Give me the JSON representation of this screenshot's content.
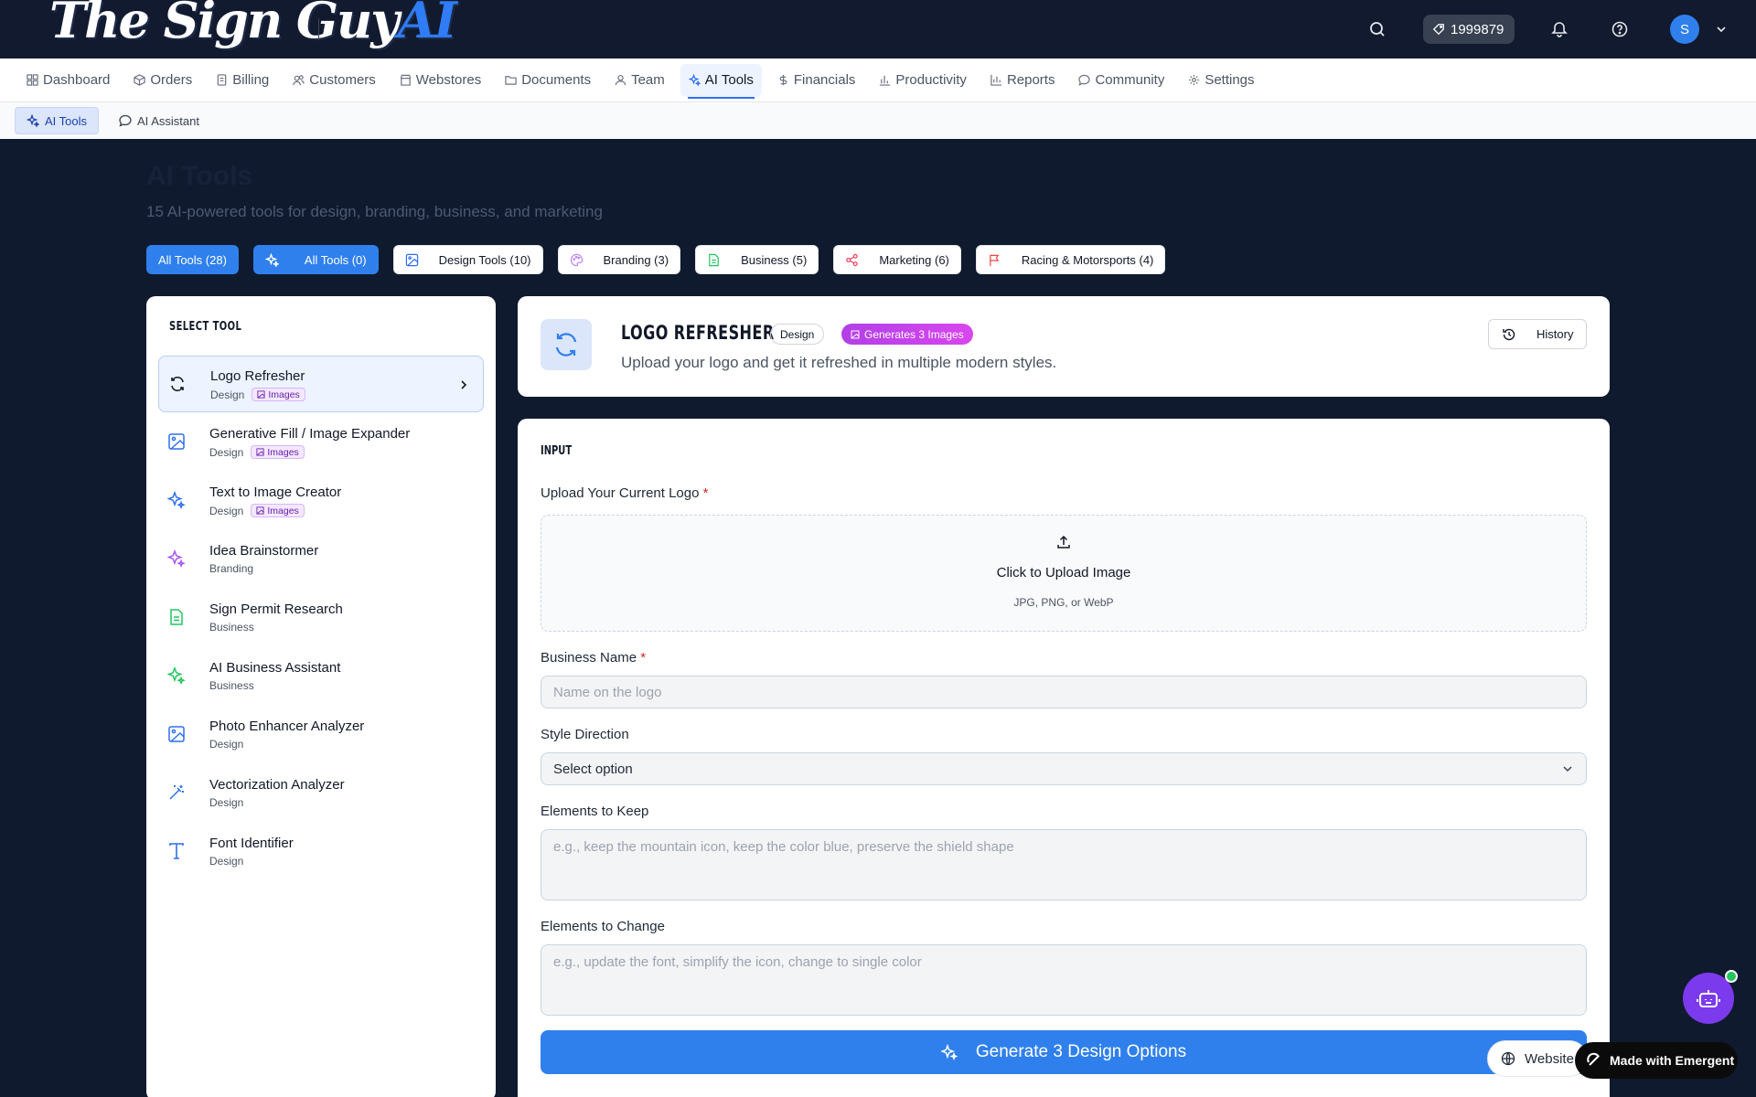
{
  "app": {
    "logo_main": "The Sign Guy",
    "logo_ai": "AI",
    "credits": "1999879",
    "avatar_initial": "S"
  },
  "nav": {
    "items": [
      {
        "label": "Dashboard",
        "icon": "grid-icon"
      },
      {
        "label": "Orders",
        "icon": "box-icon"
      },
      {
        "label": "Billing",
        "icon": "document-icon"
      },
      {
        "label": "Customers",
        "icon": "users-icon"
      },
      {
        "label": "Webstores",
        "icon": "store-icon"
      },
      {
        "label": "Documents",
        "icon": "folder-icon"
      },
      {
        "label": "Team",
        "icon": "user-icon"
      },
      {
        "label": "AI Tools",
        "icon": "sparkles-icon",
        "active": true
      },
      {
        "label": "Financials",
        "icon": "dollar-icon"
      },
      {
        "label": "Productivity",
        "icon": "bar-chart-icon"
      },
      {
        "label": "Reports",
        "icon": "chart-icon"
      },
      {
        "label": "Community",
        "icon": "chat-icon"
      },
      {
        "label": "Settings",
        "icon": "gear-icon"
      }
    ]
  },
  "subnav": {
    "items": [
      {
        "label": "AI Tools",
        "icon": "sparkles-icon",
        "active": true
      },
      {
        "label": "AI Assistant",
        "icon": "chat-icon"
      }
    ]
  },
  "page": {
    "title": "AI Tools",
    "subtitle": "15 AI-powered tools for design, branding, business, and marketing"
  },
  "filters": [
    {
      "label": "All Tools (28)"
    },
    {
      "label": "All Tools (0)",
      "icon": "sparkles-icon"
    },
    {
      "label": "Design Tools (10)",
      "icon": "image-icon"
    },
    {
      "label": "Branding (3)",
      "icon": "palette-icon"
    },
    {
      "label": "Business (5)",
      "icon": "file-icon"
    },
    {
      "label": "Marketing (6)",
      "icon": "share-icon"
    },
    {
      "label": "Racing & Motorsports (4)",
      "icon": "flag-icon"
    }
  ],
  "tool_list": {
    "title": "SELECT TOOL",
    "images_badge": "Images",
    "items": [
      {
        "name": "Logo Refresher",
        "category": "Design",
        "images": true,
        "selected": true,
        "icon": "refresh-icon"
      },
      {
        "name": "Generative Fill / Image Expander",
        "category": "Design",
        "images": true,
        "icon": "image-icon"
      },
      {
        "name": "Text to Image Creator",
        "category": "Design",
        "images": true,
        "icon": "sparkles-icon"
      },
      {
        "name": "Idea Brainstormer",
        "category": "Branding",
        "images": false,
        "icon": "sparkles-icon"
      },
      {
        "name": "Sign Permit Research",
        "category": "Business",
        "images": false,
        "icon": "file-icon"
      },
      {
        "name": "AI Business Assistant",
        "category": "Business",
        "images": false,
        "icon": "sparkles-icon"
      },
      {
        "name": "Photo Enhancer Analyzer",
        "category": "Design",
        "images": false,
        "icon": "image-icon"
      },
      {
        "name": "Vectorization Analyzer",
        "category": "Design",
        "images": false,
        "icon": "wand-icon"
      },
      {
        "name": "Font Identifier",
        "category": "Design",
        "images": false,
        "icon": "type-icon"
      }
    ]
  },
  "tool_header": {
    "title": "LOGO REFRESHER",
    "category": "Design",
    "badge": "Generates 3 Images",
    "description": "Upload your logo and get it refreshed in multiple modern styles.",
    "history_label": "History"
  },
  "form": {
    "section_title": "INPUT",
    "upload_label": "Upload Your Current Logo",
    "required_mark": "*",
    "upload_title": "Click to Upload Image",
    "upload_sub": "JPG, PNG, or WebP",
    "business_label": "Business Name",
    "business_placeholder": "Name on the logo",
    "style_label": "Style Direction",
    "style_value": "Select option",
    "keep_label": "Elements to Keep",
    "keep_placeholder": "e.g., keep the mountain icon, keep the color blue, preserve the shield shape",
    "change_label": "Elements to Change",
    "change_placeholder": "e.g., update the font, simplify the icon, change to single color",
    "generate_label": "Generate 3 Design Options"
  },
  "floating": {
    "website_label": "Website",
    "emergent_label": "Made with Emergent"
  },
  "colors": {
    "accent": "#2f80ed",
    "topbar": "#111a2e",
    "generates_badge": "#c026d3"
  }
}
